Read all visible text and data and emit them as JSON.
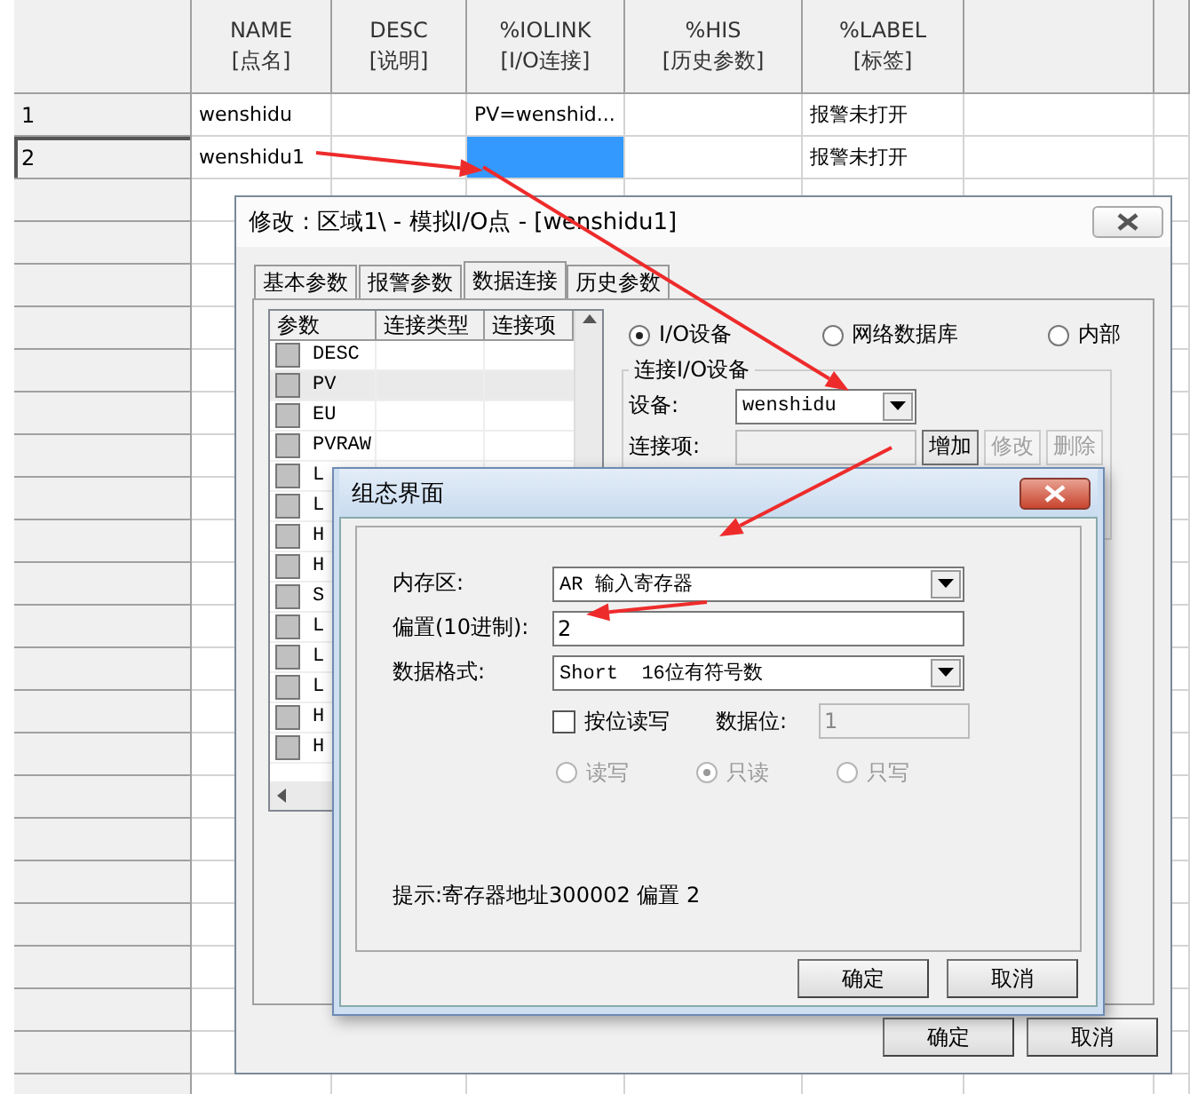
{
  "grid": {
    "columns": [
      {
        "name": "NAME",
        "sub": "[点名]"
      },
      {
        "name": "DESC",
        "sub": "[说明]"
      },
      {
        "name": "%IOLINK",
        "sub": "[I/O连接]"
      },
      {
        "name": "%HIS",
        "sub": "[历史参数]"
      },
      {
        "name": "%LABEL",
        "sub": "[标签]"
      }
    ],
    "rows": [
      {
        "number": "1",
        "current": false,
        "cells": [
          {
            "text": "wenshidu",
            "selected": false
          },
          {
            "selected": false
          },
          {
            "text": "PV=wenshid...",
            "selected": false
          },
          {
            "selected": false
          },
          {
            "text": "报警未打开",
            "selected": false
          }
        ]
      },
      {
        "number": "2",
        "current": true,
        "cells": [
          {
            "text": "wenshidu1",
            "selected": false
          },
          {
            "selected": false
          },
          {
            "selected": true
          },
          {
            "selected": false
          },
          {
            "text": "报警未打开",
            "selected": false
          }
        ]
      }
    ]
  },
  "edit_dialog": {
    "title": "修改 : 区域1\\ - 模拟I/O点 - [wenshidu1]",
    "tabs": [
      {
        "label": "基本参数",
        "selected": false
      },
      {
        "label": "报警参数",
        "selected": false
      },
      {
        "label": "数据连接",
        "selected": true
      },
      {
        "label": "历史参数",
        "selected": false
      }
    ],
    "param_list": {
      "columns": [
        "参数",
        "连接类型",
        "连接项"
      ],
      "rows": [
        {
          "name": "DESC",
          "selected": false
        },
        {
          "name": "PV",
          "selected": true
        },
        {
          "name": "EU",
          "selected": false
        },
        {
          "name": "PVRAW",
          "selected": false
        },
        {
          "name": "L",
          "selected": false
        },
        {
          "name": "L",
          "selected": false
        },
        {
          "name": "H",
          "selected": false
        },
        {
          "name": "H",
          "selected": false
        },
        {
          "name": "S",
          "selected": false
        },
        {
          "name": "L",
          "selected": false
        },
        {
          "name": "L",
          "selected": false
        },
        {
          "name": "L",
          "selected": false
        },
        {
          "name": "H",
          "selected": false
        },
        {
          "name": "H",
          "selected": false
        }
      ]
    },
    "source_options": [
      {
        "label": "I/O设备",
        "selected": true
      },
      {
        "label": "网络数据库",
        "selected": false
      },
      {
        "label": "内部",
        "selected": false
      }
    ],
    "io_group": {
      "title": "连接I/O设备",
      "device_label": "设备:",
      "device_value": "wenshidu",
      "link_label": "连接项:",
      "buttons": [
        {
          "label": "增加",
          "disabled": false
        },
        {
          "label": "修改",
          "disabled": true
        },
        {
          "label": "删除",
          "disabled": true
        }
      ]
    },
    "buttons": [
      "确定",
      "取消"
    ]
  },
  "config_dialog": {
    "title": "组态界面",
    "memory_label": "内存区:",
    "memory_value": "AR 输入寄存器",
    "offset_label": "偏置(10进制):",
    "offset_value": "2",
    "format_label": "数据格式:",
    "format_value": "Short  16位有符号数",
    "bit_rw": {
      "label": "按位读写",
      "checked": false
    },
    "bit_label": "数据位:",
    "bit_value": "1",
    "access_disabled": true,
    "access": [
      {
        "label": "读写",
        "selected": false
      },
      {
        "label": "只读",
        "selected": true
      },
      {
        "label": "只写",
        "selected": false
      }
    ],
    "hint": "提示:寄存器地址300002 偏置 2",
    "buttons": [
      "确定",
      "取消"
    ]
  }
}
